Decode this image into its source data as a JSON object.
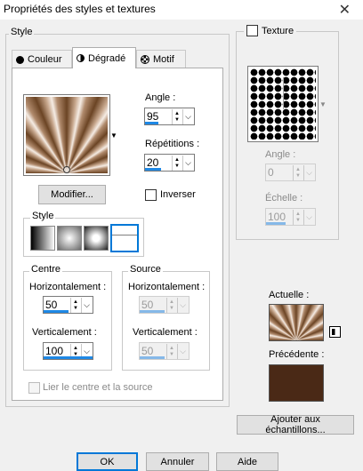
{
  "window": {
    "title": "Propriétés des styles et textures"
  },
  "style_group": {
    "legend": "Style",
    "tabs": [
      {
        "label": "Couleur",
        "icon": "color-dot-icon"
      },
      {
        "label": "Dégradé",
        "icon": "gradient-half-icon"
      },
      {
        "label": "Motif",
        "icon": "pattern-icon"
      }
    ],
    "active_tab": "Dégradé"
  },
  "gradient": {
    "angle_label": "Angle :",
    "angle_value": "95",
    "repetitions_label": "Répétitions :",
    "repetitions_value": "20",
    "invert_label": "Inverser",
    "invert_checked": false,
    "modify_button": "Modifier...",
    "style_label": "Style",
    "style_options": [
      "linear",
      "rectangular",
      "sunburst",
      "radial"
    ],
    "selected_style": "radial"
  },
  "centre": {
    "legend": "Centre",
    "horizontal_label": "Horizontalement :",
    "horizontal_value": "50",
    "vertical_label": "Verticalement :",
    "vertical_value": "100"
  },
  "source": {
    "legend": "Source",
    "horizontal_label": "Horizontalement :",
    "horizontal_value": "50",
    "vertical_label": "Verticalement :",
    "vertical_value": "50"
  },
  "link_label": "Lier le centre et la source",
  "texture": {
    "label": "Texture",
    "checked": false,
    "angle_label": "Angle :",
    "angle_value": "0",
    "scale_label": "Échelle :",
    "scale_value": "100"
  },
  "preview": {
    "current_label": "Actuelle :",
    "previous_label": "Précédente :",
    "previous_color": "#4a2916"
  },
  "add_samples_button": "Ajouter aux échantillons...",
  "footer": {
    "ok": "OK",
    "cancel": "Annuler",
    "help": "Aide"
  },
  "colors": {
    "accent": "#0078d7",
    "progress": "#1e88e5"
  }
}
